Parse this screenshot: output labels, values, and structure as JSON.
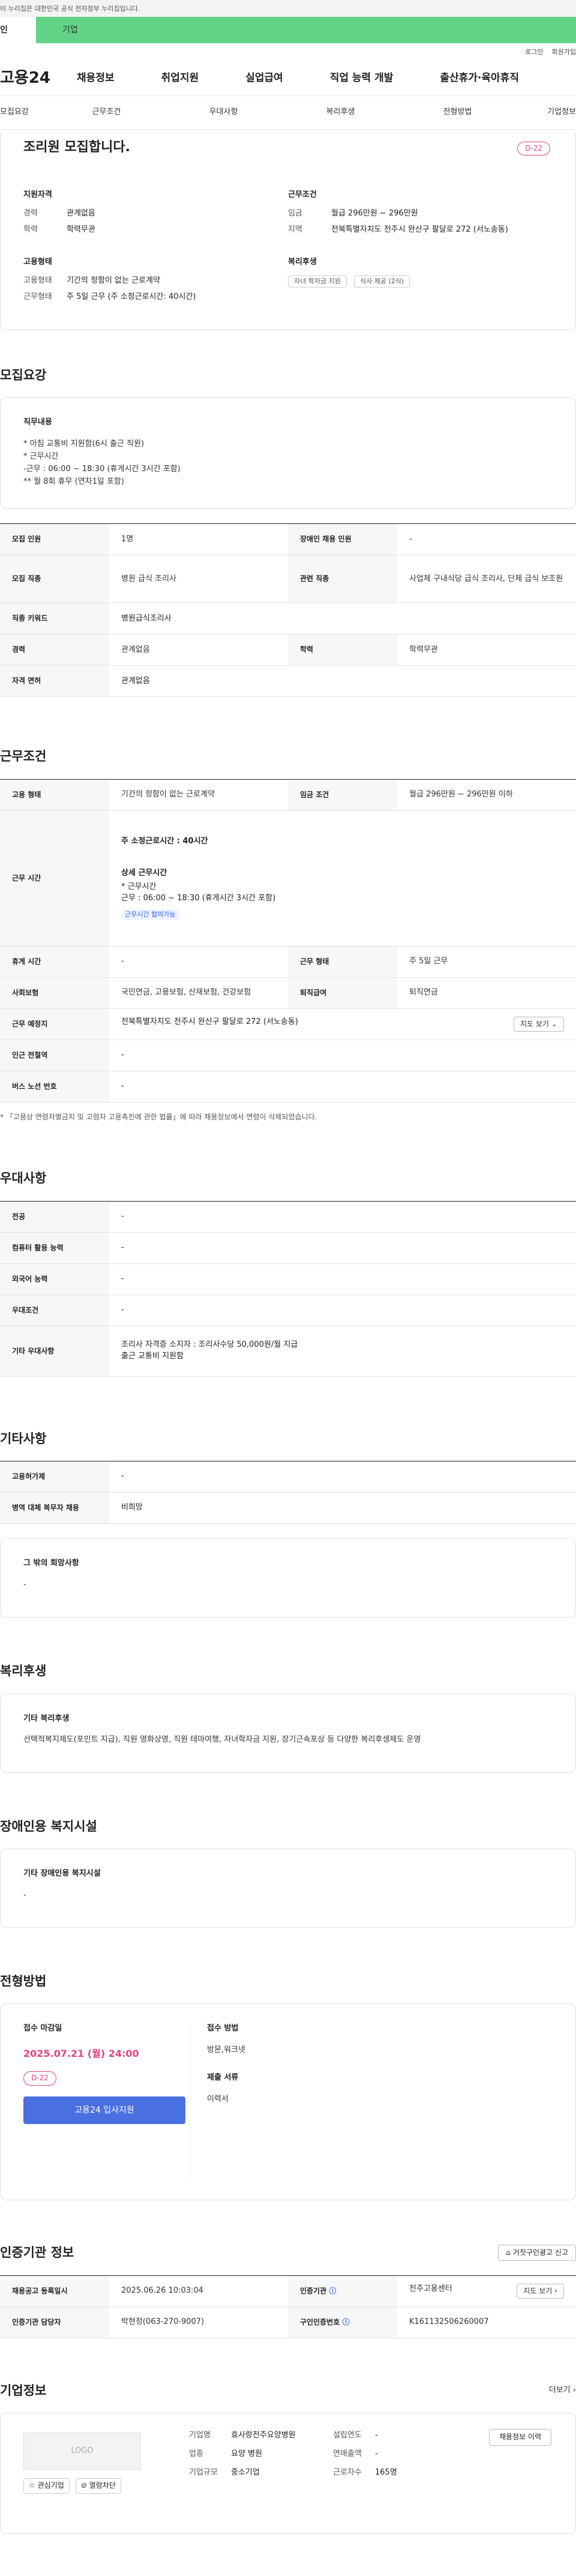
{
  "gov_notice": "이 누리집은 대한민국 공식 전자정부 누리집입니다.",
  "gov_left": "인",
  "gov_bar": "기업",
  "util_links": [
    "로그인",
    "회원가입"
  ],
  "logo": "고용24",
  "gnb": [
    "채용정보",
    "취업지원",
    "실업급여",
    "직업 능력 개발",
    "출산휴가·육아휴직"
  ],
  "tabs": [
    "모집요강",
    "근무조건",
    "우대사항",
    "복리후생",
    "전형방법",
    "기업정보"
  ],
  "summary": {
    "title": "조리원 모집합니다.",
    "dday": "D-22",
    "qual_heading": "지원자격",
    "career_label": "경력",
    "career": "관계없음",
    "edu_label": "학력",
    "edu": "학력무관",
    "cond_heading": "근무조건",
    "wage_label": "임금",
    "wage": "월급 296만원 ~ 296만원",
    "region_label": "지역",
    "region": "전북특별자치도 전주시 완산구 팔달로 272 (서노송동)",
    "emp_heading": "고용형태",
    "emp_type_label": "고용형태",
    "emp_type": "기간의 정함이 없는 근로계약",
    "work_type_label": "근무형태",
    "work_type": "주 5일 근무 (주 소정근로시간: 40시간)",
    "welfare_heading": "복리후생",
    "welfare_chips": [
      "자녀 학자금 지원",
      "식사 제공 (2식)"
    ]
  },
  "recruit": {
    "heading": "모집요강",
    "duty_heading": "직무내용",
    "duty_text": "* 아침 교통비 지원함(6시 출근 직원)\n* 근무시간\n -근무 : 06:00 ~ 18:30 (휴게시간  3시간 포함)\n**  월 8회 휴무 (연차1일 포함)",
    "rows": [
      {
        "l1": "모집 인원",
        "v1": "1명",
        "l2": "장애인 채용 인원",
        "v2": "-"
      },
      {
        "l1": "모집 직종",
        "v1": "병원 급식 조리사",
        "l2": "관련 직종",
        "v2": "사업체 구내식당 급식 조리사, 단체 급식 보조원"
      },
      {
        "l1": "직종 키워드",
        "v1": "병원급식조리사"
      },
      {
        "l1": "경력",
        "v1": "관계없음",
        "l2": "학력",
        "v2": "학력무관"
      },
      {
        "l1": "자격 면허",
        "v1": "관계없음"
      }
    ]
  },
  "conditions": {
    "heading": "근무조건",
    "emp_label": "고용 형태",
    "emp": "기간의 정함이 없는 근로계약",
    "wage_label": "임금 조건",
    "wage": "월급 296만원 ~ 296만원 이하",
    "hours_label": "근무 시간",
    "hours_weekly": "주 소정근로시간 : 40시간",
    "hours_detail_heading": "상세 근무시간",
    "hours_detail": "* 근무시간\n  근무 : 06:00 ~ 18:30 (휴게시간  3시간 포함)",
    "hours_badge": "근무시간 협의가능",
    "break_label": "휴게 시간",
    "break": "-",
    "form_label": "근무 형태",
    "form": "주 5일 근무",
    "ins_label": "사회보험",
    "ins": "국민연금, 고용보험, 산재보험, 건강보험",
    "sev_label": "퇴직급여",
    "sev": "퇴직연금",
    "place_label": "근무 예정지",
    "place": "전북특별자치도 전주시 완산구 팔달로 272 (서노송동)",
    "map_btn": "지도 보기",
    "subway_label": "인근 전철역",
    "subway": "-",
    "bus_label": "버스 노선 번호",
    "bus": "-",
    "note": "* 「고용상 연령차별금지 및 고령자 고용촉진에 관한 법률」에 따라 채용정보에서 연령이 삭제되었습니다."
  },
  "preference": {
    "heading": "우대사항",
    "rows": [
      {
        "l": "전공",
        "v": "-"
      },
      {
        "l": "컴퓨터 활용 능력",
        "v": "-"
      },
      {
        "l": "외국어 능력",
        "v": "-"
      },
      {
        "l": "우대조건",
        "v": "-"
      },
      {
        "l": "기타 우대사항",
        "v": "조리사 자격증 소지자 : 조리사수당 50,000원/월 지급\n출근 교통비 지원함"
      }
    ]
  },
  "other": {
    "heading": "기타사항",
    "rows": [
      {
        "l": "고용허가제",
        "v": "-"
      },
      {
        "l": "병역 대체 복무자 채용",
        "v": "비희망"
      }
    ],
    "extra_heading": "그 밖의 희망사항",
    "extra_text": "-"
  },
  "welfare": {
    "heading": "복리후생",
    "box_heading": "기타 복리후생",
    "box_text": "선택적복지제도(포인트 지급), 직원 영화상영, 직원 테마여행, 자녀학자금 지원, 장기근속포상 등 다양한 복리후생제도 운영"
  },
  "disability": {
    "heading": "장애인용 복지시설",
    "box_heading": "기타 장애인용 복지시설",
    "box_text": "-"
  },
  "apply": {
    "heading": "전형방법",
    "deadline_label": "접수 마감일",
    "deadline": "2025.07.21 (월) 24:00",
    "dday": "D-22",
    "button": "고용24 입사지원",
    "method_label": "접수 방법",
    "method": "방문,워크넷",
    "docs_label": "제출 서류",
    "docs": "이력서"
  },
  "agency": {
    "heading": "인증기관 정보",
    "report_btn": "거짓구인광고 신고",
    "rows": [
      {
        "l1": "채용공고 등록일시",
        "v1": "2025.06.26 10:03:04",
        "l2": "인증기관",
        "v2": "전주고용센터"
      },
      {
        "l1": "인증기관 담당자",
        "v1": "박현정(063-270-9007)",
        "l2": "구인인증번호",
        "v2": "K161132506260007"
      }
    ],
    "map_btn": "지도 보기"
  },
  "company": {
    "heading": "기업정보",
    "more": "더보기",
    "logo_text": "LOGO",
    "fav_btn": "관심기업",
    "block_btn": "열람차단",
    "name_label": "기업명",
    "name": "효사랑전주요양병원",
    "industry_label": "업종",
    "industry": "요양 병원",
    "size_label": "기업규모",
    "size": "중소기업",
    "year_label": "설립연도",
    "year": "-",
    "sales_label": "연매출액",
    "sales": "-",
    "emp_label": "근로자수",
    "emp": "165명",
    "hire_btn": "채용정보 이력"
  }
}
